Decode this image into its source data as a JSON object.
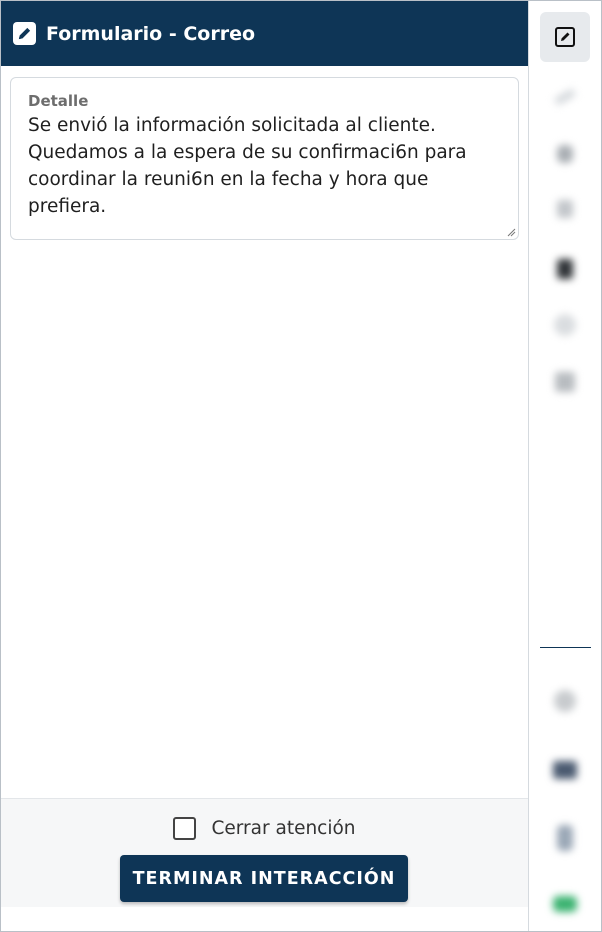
{
  "header": {
    "title": "Formulario - Correo",
    "icon": "edit-pencil-icon"
  },
  "detail": {
    "label": "Detalle",
    "value": "Se envió la información solicitada al cliente.\nQuedamos a la espera de su confirmaci6n para\ncoordinar la reuni6n en la fecha y hora que prefiera."
  },
  "footer": {
    "checkbox_label": "Cerrar atención",
    "checkbox_checked": false,
    "button_label": "TERMINAR INTERACCIÓN"
  },
  "sidebar": {
    "items": [
      {
        "icon": "edit-icon",
        "active": true
      },
      {
        "icon": "link-icon",
        "active": false
      },
      {
        "icon": "user-icon",
        "active": false
      },
      {
        "icon": "copy-icon",
        "active": false
      },
      {
        "icon": "document-icon",
        "active": false
      },
      {
        "icon": "globe-icon",
        "active": false
      },
      {
        "icon": "calendar-icon",
        "active": false
      },
      {
        "icon": "help-icon",
        "active": false
      },
      {
        "icon": "chat-icon",
        "active": false
      },
      {
        "icon": "phone-icon",
        "active": false
      },
      {
        "icon": "whatsapp-icon",
        "active": false
      }
    ]
  },
  "colors": {
    "brand": "#0e3556",
    "whatsapp": "#3cb371"
  }
}
